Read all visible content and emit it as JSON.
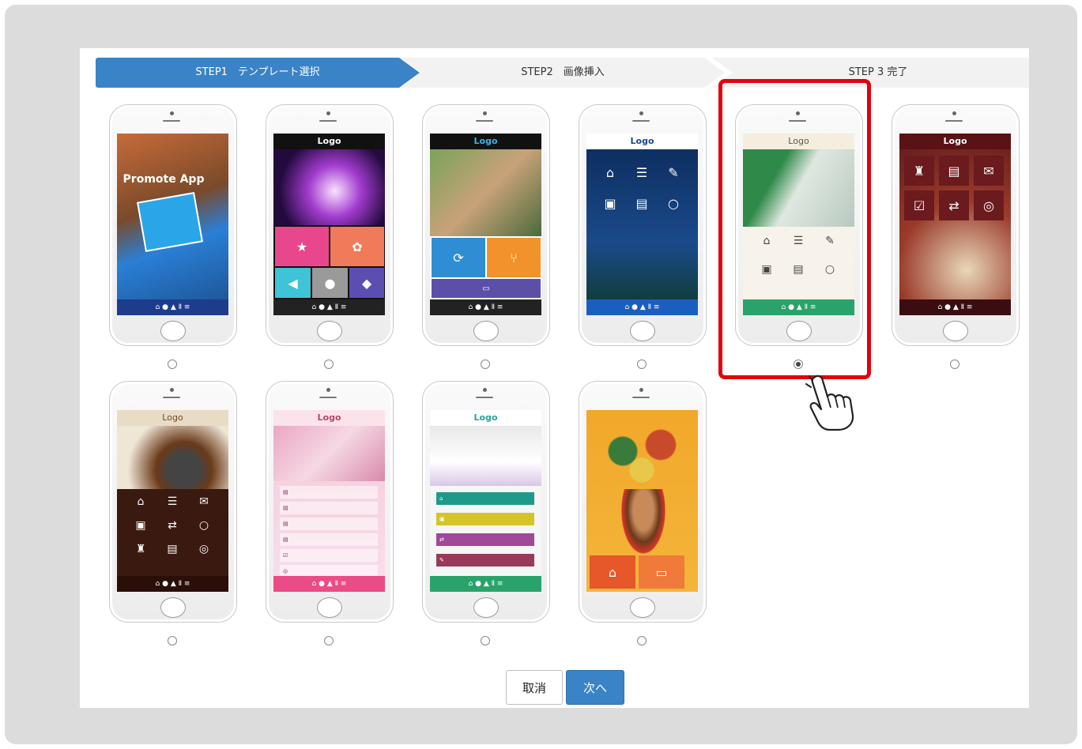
{
  "steps": [
    {
      "label": "STEP1　テンプレート選択",
      "state": "active"
    },
    {
      "label": "STEP2　画像挿入",
      "state": "inactive"
    },
    {
      "label": "STEP 3 完了",
      "state": "inactive"
    }
  ],
  "templates": [
    {
      "logo": "Promote App",
      "selected": false
    },
    {
      "logo": "Logo",
      "selected": false
    },
    {
      "logo": "Logo",
      "selected": false
    },
    {
      "logo": "Logo",
      "selected": false
    },
    {
      "logo": "Logo",
      "selected": true
    },
    {
      "logo": "Logo",
      "selected": false
    },
    {
      "logo": "Logo",
      "selected": false
    },
    {
      "logo": "Logo",
      "selected": false
    },
    {
      "logo": "Logo",
      "selected": false
    },
    {
      "logo": "",
      "selected": false
    }
  ],
  "buttons": {
    "cancel": "取消",
    "next": "次へ"
  },
  "colors": {
    "accent": "#3a83c6",
    "highlight": "#e3000b"
  }
}
